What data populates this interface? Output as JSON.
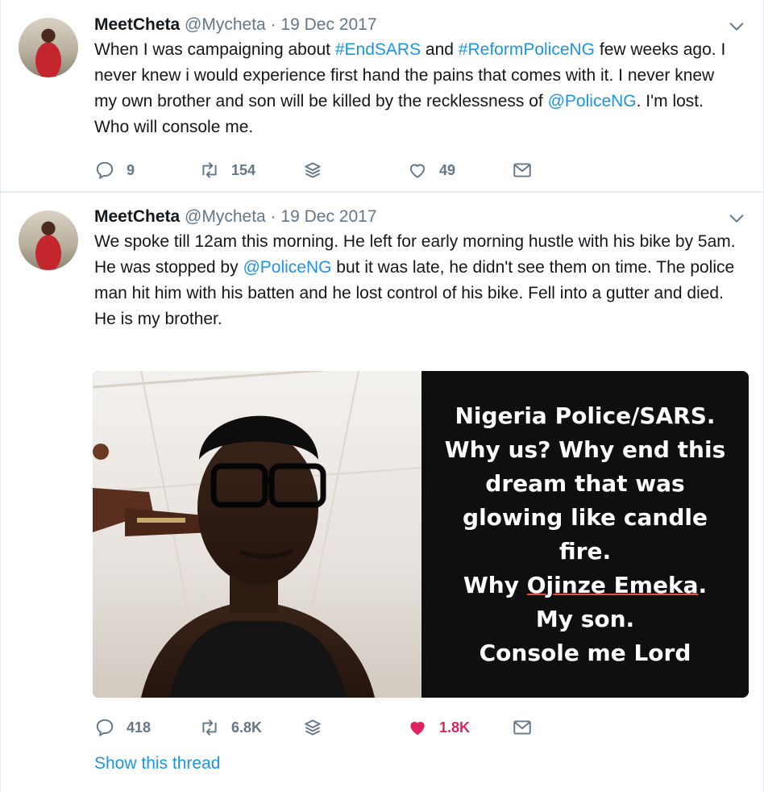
{
  "tweets": [
    {
      "author": {
        "name": "MeetCheta",
        "handle": "@Mycheta",
        "date": "19 Dec 2017"
      },
      "text": {
        "p1": "When I was campaigning about ",
        "hashtag1": "#EndSARS",
        "p2": " and ",
        "hashtag2": "#ReformPoliceNG",
        "p3": " few weeks ago. I never knew i would experience first hand the pains that comes with it. I never knew my own brother and son will be killed by the recklessness of ",
        "mention": "@PoliceNG",
        "p4": ". I'm lost. Who will console me."
      },
      "actions": {
        "replies": "9",
        "retweets": "154",
        "likes": "49"
      }
    },
    {
      "author": {
        "name": "MeetCheta",
        "handle": "@Mycheta",
        "date": "19 Dec 2017"
      },
      "text": {
        "p1": "We spoke till 12am this morning. He left for early morning hustle with his bike by 5am. He was stopped by ",
        "mention": "@PoliceNG",
        "p2": " but it was late, he didn't see them on time. The police man hit him with his batten and he lost control of his bike. Fell into a gutter and died.",
        "p3": "He is my brother."
      },
      "media": {
        "caption": {
          "l1": "Nigeria Police/SARS.",
          "l2": "Why us? Why end this",
          "l3": "dream that was",
          "l4": "glowing like candle",
          "l5": "fire.",
          "l6a": "Why ",
          "l6b": "Ojinze Emeka",
          "l6c": ".",
          "l7": "My son.",
          "l8": "Console me Lord"
        }
      },
      "actions": {
        "replies": "418",
        "retweets": "6.8K",
        "likes": "1.8K"
      },
      "show_thread": "Show this thread"
    }
  ],
  "icons": {
    "reply": "reply-icon",
    "retweet": "retweet-icon",
    "stack": "layers-icon",
    "like": "heart-icon",
    "dm": "mail-icon",
    "chevron": "chevron-down-icon"
  },
  "colors": {
    "link": "#1b95e0",
    "muted": "#657786",
    "like": "#e0245e"
  }
}
